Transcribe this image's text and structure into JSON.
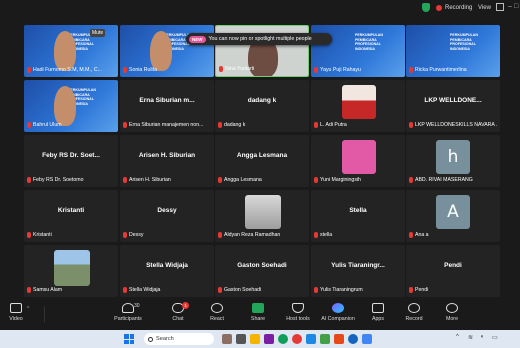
{
  "topbar": {
    "recording_label": "Recording",
    "view_label": "View"
  },
  "banner": {
    "badge": "NEW",
    "text": "You can now pin or spotlight multiple people"
  },
  "mute_label": "Mute",
  "slide_title": "PERKUMPULAN PEMBICARA PROFESIONAL INDONESIA",
  "tiles": [
    {
      "label": "Hadi Furnomo S.M, M.M., C...",
      "kind": "slide-cam"
    },
    {
      "label": "Sonia Rulita",
      "kind": "slide-cam"
    },
    {
      "label": "Nina Yuniarti",
      "kind": "cam-active"
    },
    {
      "label": "Yayu Puji Rahayu",
      "kind": "slide"
    },
    {
      "label": "Ricka Purwantimerlina",
      "kind": "slide"
    },
    {
      "label": "Bahrul Ulum",
      "kind": "slide-cam"
    },
    {
      "name": "Erna Siburian m...",
      "label": "Erna Siburian manajemen non...",
      "kind": "name"
    },
    {
      "name": "dadang k",
      "label": "dadang k",
      "kind": "name"
    },
    {
      "label": "L. Adi Putra",
      "kind": "photo-red"
    },
    {
      "name": "LKP WELLDONE...",
      "label": "LKP WELLDONESKILLS NAVARA ...",
      "kind": "name"
    },
    {
      "name": "Feby RS Dr. Soet...",
      "label": "Feby RS Dr. Soetomo",
      "kind": "name"
    },
    {
      "name": "Arisen H. Siburian",
      "label": "Arisen H. Siburian",
      "kind": "name"
    },
    {
      "name": "Angga Lesmana",
      "label": "Angga Lesmana",
      "kind": "name"
    },
    {
      "label": "Yuni Marginingsih",
      "kind": "pink"
    },
    {
      "avatar": "h",
      "label": "ABD. RIVAI MASERANG",
      "kind": "avatar"
    },
    {
      "name": "Kristanti",
      "label": "Kristanti",
      "kind": "name"
    },
    {
      "name": "Dessy",
      "label": "Dessy",
      "kind": "name"
    },
    {
      "label": "Aldyan Reza Ramadhan",
      "kind": "photo-gray"
    },
    {
      "name": "Stella",
      "label": "stella",
      "kind": "name"
    },
    {
      "avatar": "A",
      "label": "Ana a",
      "kind": "avatar"
    },
    {
      "label": "Samsu Alam",
      "kind": "photo-outdoor"
    },
    {
      "name": "Stella Widjaja",
      "label": "Stella Widjaja",
      "kind": "name"
    },
    {
      "name": "Gaston Soehadi",
      "label": "Gaston Soehadi",
      "kind": "name"
    },
    {
      "name": "Yulis Tiaraningr...",
      "label": "Yulis Tiaraningrum",
      "kind": "name"
    },
    {
      "name": "Pendi",
      "label": "Pendi",
      "kind": "name"
    }
  ],
  "toolbar": {
    "video": "Video",
    "participants": "Participants",
    "participants_count": "30",
    "chat": "Chat",
    "chat_badge": "1",
    "react": "React",
    "share": "Share",
    "host_tools": "Host tools",
    "ai": "AI Companion",
    "apps": "Apps",
    "record": "Record",
    "more": "More"
  },
  "taskbar": {
    "search_placeholder": "Search"
  },
  "colors": {
    "accent_red": "#e53935",
    "slide_blue": "#2e77d8",
    "active_border": "#6fd16f"
  }
}
